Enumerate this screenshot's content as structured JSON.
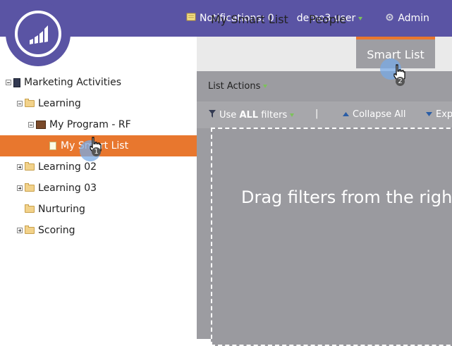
{
  "header": {
    "notifications_label": "Notifications: 0",
    "user_label": "demo3 user",
    "admin_label": "Admin"
  },
  "tree": {
    "items": [
      {
        "label": "Marketing Activities"
      },
      {
        "label": "Learning"
      },
      {
        "label": "My Program - RF"
      },
      {
        "label": "My Smart List"
      },
      {
        "label": "Learning 02"
      },
      {
        "label": "Learning 03"
      },
      {
        "label": "Nurturing"
      },
      {
        "label": "Scoring"
      }
    ]
  },
  "tabs": [
    {
      "label": "My Smart List"
    },
    {
      "label": "People"
    },
    {
      "label": "Smart List"
    }
  ],
  "toolbar": {
    "list_actions_label": "List Actions",
    "use_label": "Use",
    "all_label": "ALL",
    "filters_label": "filters",
    "separator": "|",
    "collapse_all_label": "Collapse All",
    "expand_label": "Exp"
  },
  "drop_area": {
    "hint_text": "Drag filters from the right"
  },
  "step_badges": [
    "1",
    "2"
  ]
}
